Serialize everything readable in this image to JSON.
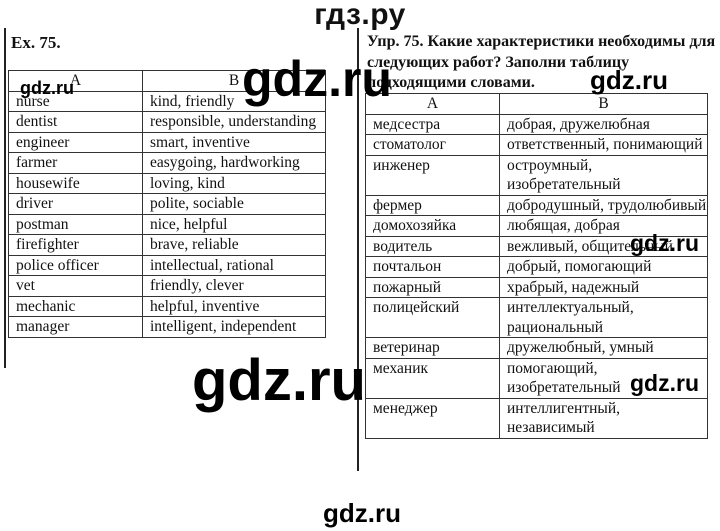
{
  "site_title": "гдз.ру",
  "watermarks": {
    "text": "gdz.ru",
    "small_label": "gdz.ru"
  },
  "english": {
    "title": "Ex.  75.",
    "headers": [
      "A",
      "B"
    ],
    "rows": [
      {
        "a": "nurse",
        "b": "kind, friendly"
      },
      {
        "a": "dentist",
        "b": "responsible, understanding"
      },
      {
        "a": "engineer",
        "b": "smart, inventive"
      },
      {
        "a": "farmer",
        "b": "easygoing, hardworking"
      },
      {
        "a": "housewife",
        "b": "loving, kind"
      },
      {
        "a": "driver",
        "b": "polite, sociable"
      },
      {
        "a": "postman",
        "b": "nice, helpful"
      },
      {
        "a": "firefighter",
        "b": "brave, reliable"
      },
      {
        "a": "police officer",
        "b": "intellectual, rational"
      },
      {
        "a": "vet",
        "b": "friendly, clever"
      },
      {
        "a": "mechanic",
        "b": "helpful, inventive"
      },
      {
        "a": "manager",
        "b": "intelligent, independent"
      }
    ]
  },
  "russian": {
    "title": "Упр. 75. Какие характеристики необходимы для следующих работ? Заполни таблицу подходящими словами.",
    "headers": [
      "A",
      "B"
    ],
    "rows": [
      {
        "a": "медсестра",
        "b": "добрая, дружелюбная"
      },
      {
        "a": "стоматолог",
        "b": "ответственный, понимающий"
      },
      {
        "a": "инженер",
        "b": "остроумный, изобретательный"
      },
      {
        "a": "фермер",
        "b": "добродушный, трудолюбивый"
      },
      {
        "a": "домохозяйка",
        "b": "любящая, добрая"
      },
      {
        "a": "водитель",
        "b": "вежливый, общительный"
      },
      {
        "a": "почтальон",
        "b": "добрый, помогающий"
      },
      {
        "a": "пожарный",
        "b": "храбрый, надежный"
      },
      {
        "a": "полицейский",
        "b": "интеллектуальный, рациональный"
      },
      {
        "a": "ветеринар",
        "b": "дружелюбный, умный"
      },
      {
        "a": "механик",
        "b": "помогающий, изобретательный"
      },
      {
        "a": "менеджер",
        "b": "интеллигентный, независимый"
      }
    ]
  }
}
